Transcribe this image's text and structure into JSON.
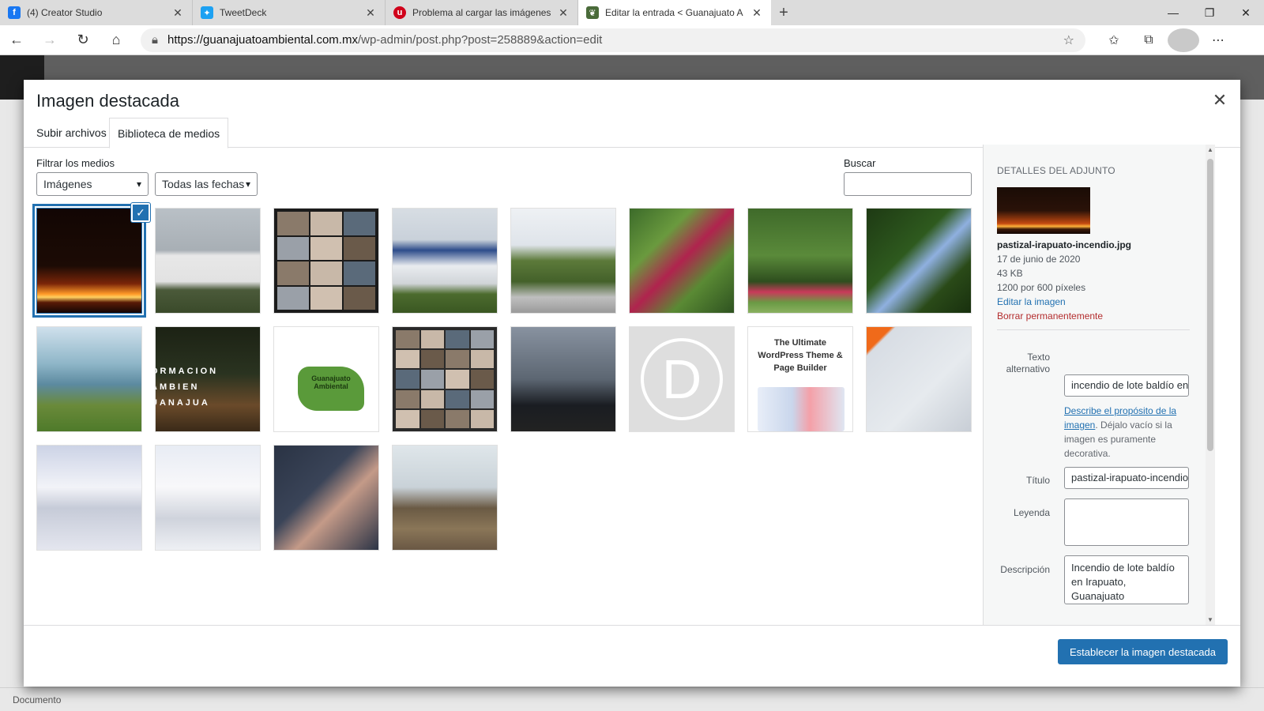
{
  "browser": {
    "tabs": [
      {
        "title": "(4) Creator Studio",
        "fav_color": "#1877f2",
        "fav_glyph": "f",
        "active": false
      },
      {
        "title": "TweetDeck",
        "fav_color": "#1da1f2",
        "fav_glyph": "t",
        "active": false
      },
      {
        "title": "Problema al cargar las imágenes",
        "fav_color": "#d0021b",
        "fav_glyph": "u",
        "active": false
      },
      {
        "title": "Editar la entrada < Guanajuato A",
        "fav_color": "#4a6b3a",
        "fav_glyph": "g",
        "active": true
      }
    ],
    "url_host": "https://guanajuatoambiental.com.mx",
    "url_path": "/wp-admin/post.php?post=258889&action=edit"
  },
  "modal": {
    "title": "Imagen destacada",
    "tabs": [
      "Subir archivos",
      "Biblioteca de medios"
    ],
    "filter_label": "Filtrar los medios",
    "type_select": "Imágenes",
    "date_select": "Todas las fechas",
    "search_label": "Buscar",
    "primary_button": "Establecer la imagen destacada"
  },
  "media": [
    {
      "name": "fire",
      "selected": true
    },
    {
      "name": "truck"
    },
    {
      "name": "videocall-1"
    },
    {
      "name": "building"
    },
    {
      "name": "tree-plaza"
    },
    {
      "name": "red-flowers"
    },
    {
      "name": "garden"
    },
    {
      "name": "blue-flowers"
    },
    {
      "name": "lake"
    },
    {
      "name": "formacion",
      "text": "ORMACION AMBIEN\nUANAJUA"
    },
    {
      "name": "map",
      "text": "Guanajuato\nAmbiental"
    },
    {
      "name": "videocall-2"
    },
    {
      "name": "laptop-dark"
    },
    {
      "name": "divi-logo",
      "text": "D"
    },
    {
      "name": "ultimate-theme",
      "text": "The Ultimate\nWordPress Theme &\nPage Builder"
    },
    {
      "name": "ui-cards"
    },
    {
      "name": "keyboard-blur"
    },
    {
      "name": "keyboard-white"
    },
    {
      "name": "laptop-typing"
    },
    {
      "name": "tree-planting"
    }
  ],
  "details": {
    "heading": "Detalles del adjunto",
    "filename": "pastizal-irapuato-incendio.jpg",
    "date": "17 de junio de 2020",
    "size": "43 KB",
    "dimensions": "1200 por 600 píxeles",
    "edit_link": "Editar la imagen",
    "delete_link": "Borrar permanentemente",
    "alt_label": "Texto alternativo",
    "alt_value": "incendio de lote baldío en Irapuato",
    "help_link": "Describe el propósito de la imagen",
    "help_text": ". Déjalo vacío si la imagen es puramente decorativa.",
    "title_label": "Título",
    "title_value": "pastizal-irapuato-incendio",
    "caption_label": "Leyenda",
    "caption_value": "",
    "desc_label": "Descripción",
    "desc_value": "Incendio de lote baldío en Irapuato, Guanajuato"
  },
  "footer_text": "Documento"
}
